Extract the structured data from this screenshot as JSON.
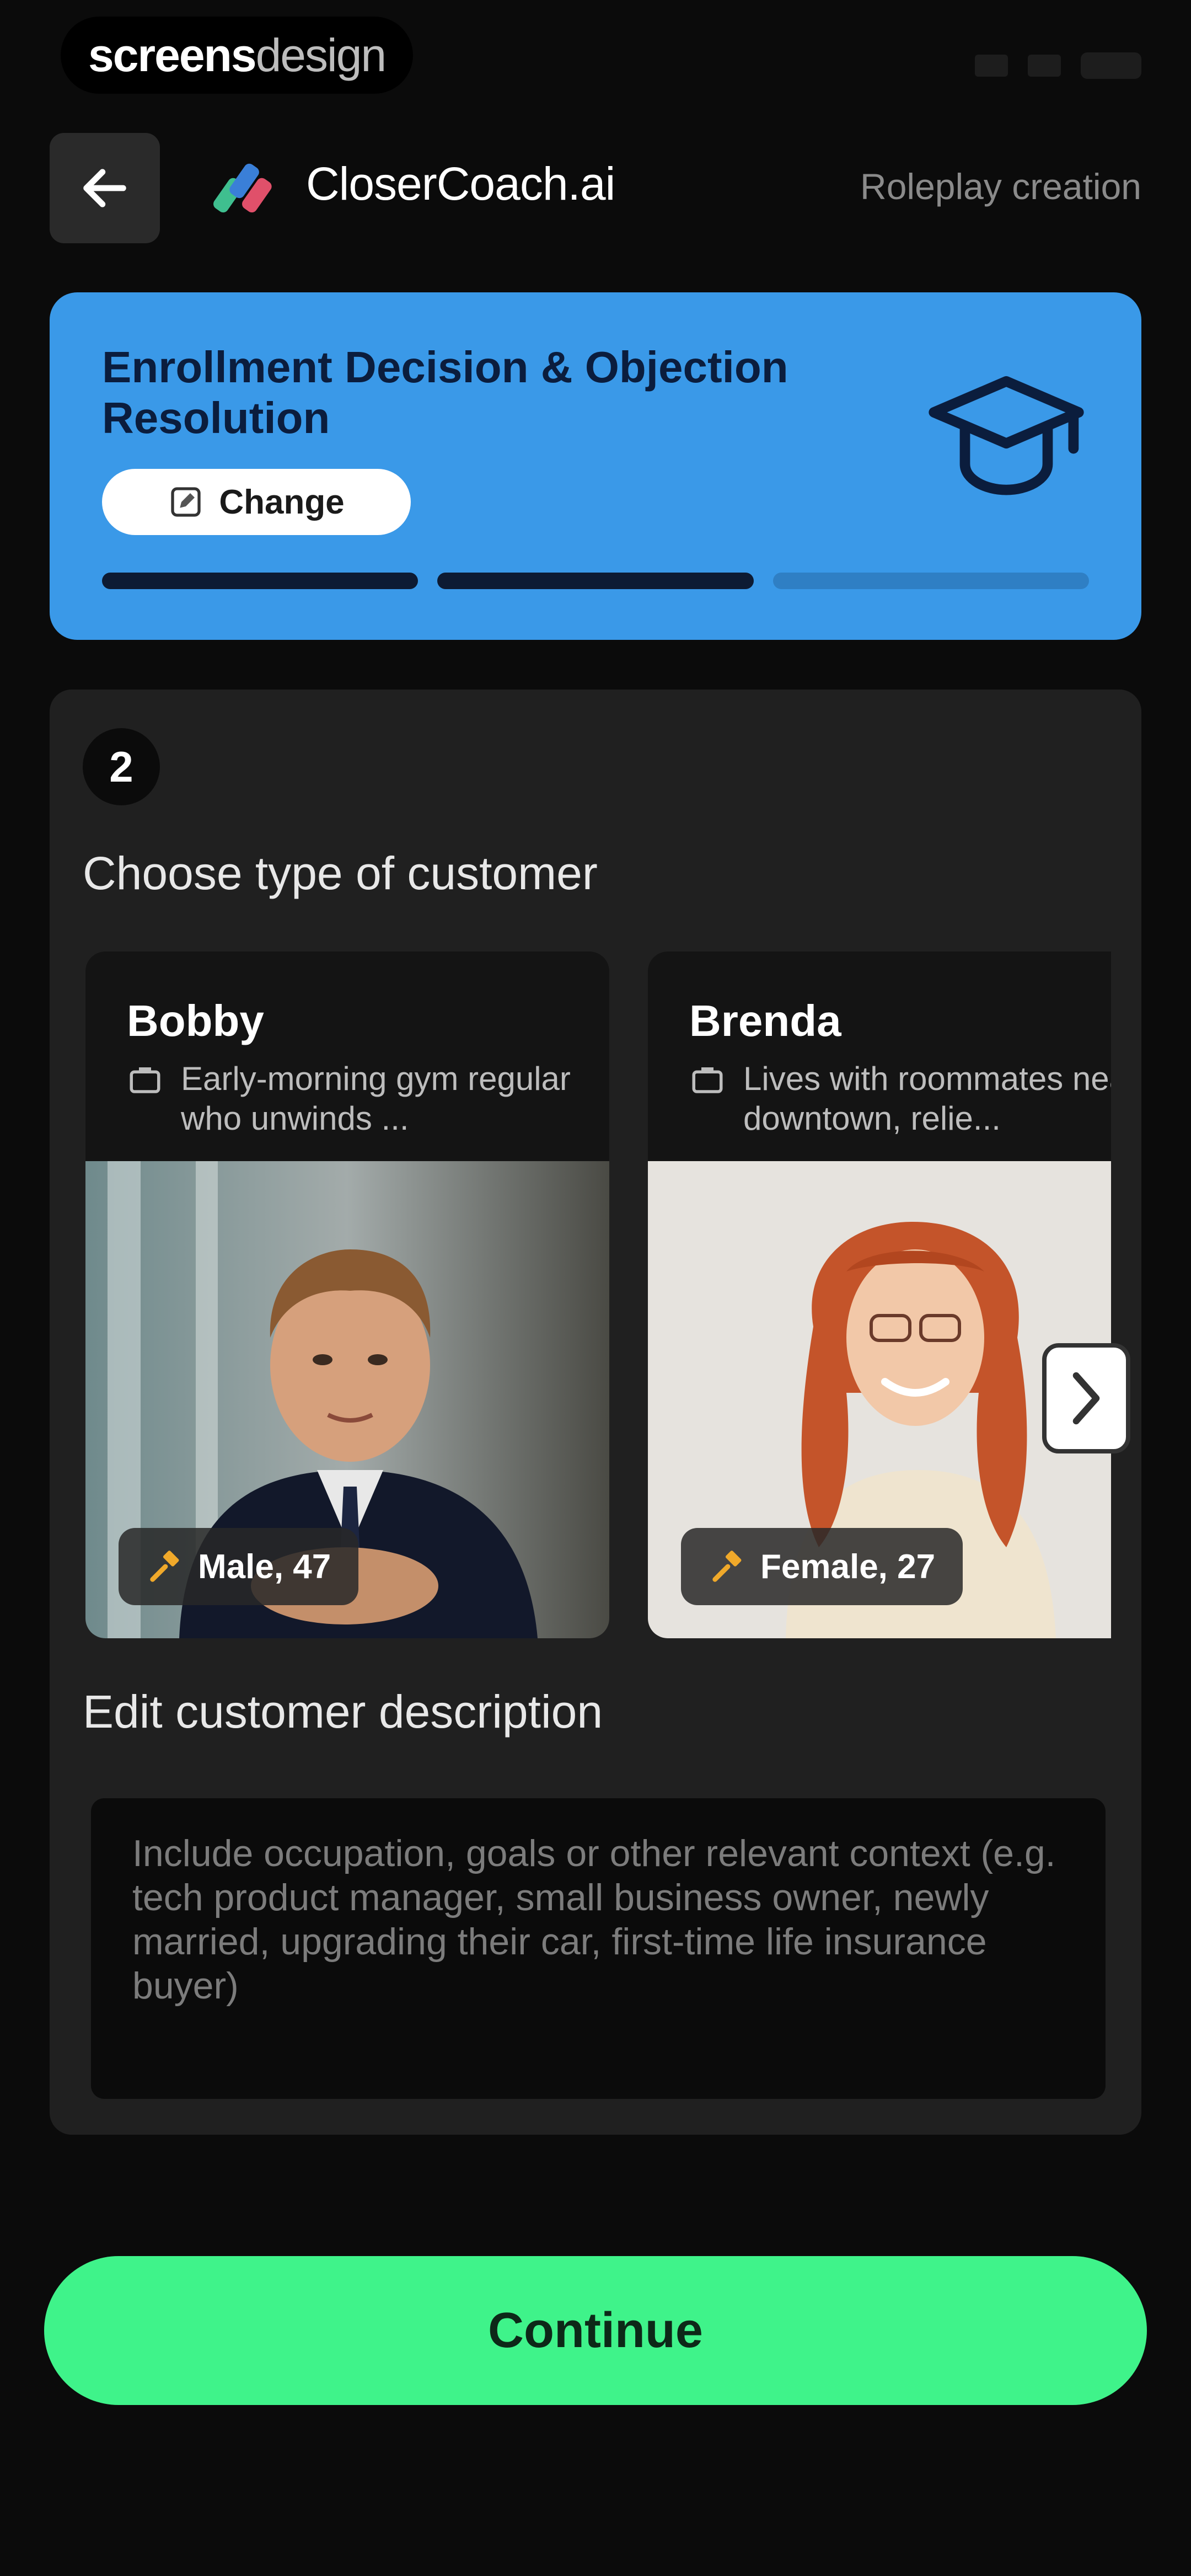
{
  "status_bar": {
    "watermark_bold": "screens",
    "watermark_light": "design"
  },
  "header": {
    "brand": "CloserCoach.ai",
    "step_title": "Roleplay creation",
    "back_icon": "arrow-left-icon",
    "logo_icon": "closercoach-logo-icon"
  },
  "scenario": {
    "title": "Enrollment Decision & Objection Resolution",
    "change_label": "Change",
    "change_icon": "edit-icon",
    "icon": "graduation-cap-icon",
    "progress": {
      "completed_steps": 2,
      "total_steps": 3
    },
    "accent_color": "#3a99e8"
  },
  "customer_step": {
    "number": "2",
    "title": "Choose type of customer",
    "customers": [
      {
        "name": "Bobby",
        "description": "Early-morning gym regular who unwinds ...",
        "tag": "Male, 47",
        "tag_icon": "gavel-icon"
      },
      {
        "name": "Brenda",
        "description": "Lives with roommates near downtown, relie...",
        "tag": "Female, 27",
        "tag_icon": "gavel-icon"
      }
    ],
    "next_icon": "chevron-right-icon"
  },
  "description": {
    "title": "Edit customer description",
    "placeholder": "Include occupation, goals or other relevant context (e.g. tech product manager, small business owner, newly married, upgrading their car, first-time life insurance buyer)"
  },
  "continue_label": "Continue",
  "continue_color": "#3ff38a"
}
